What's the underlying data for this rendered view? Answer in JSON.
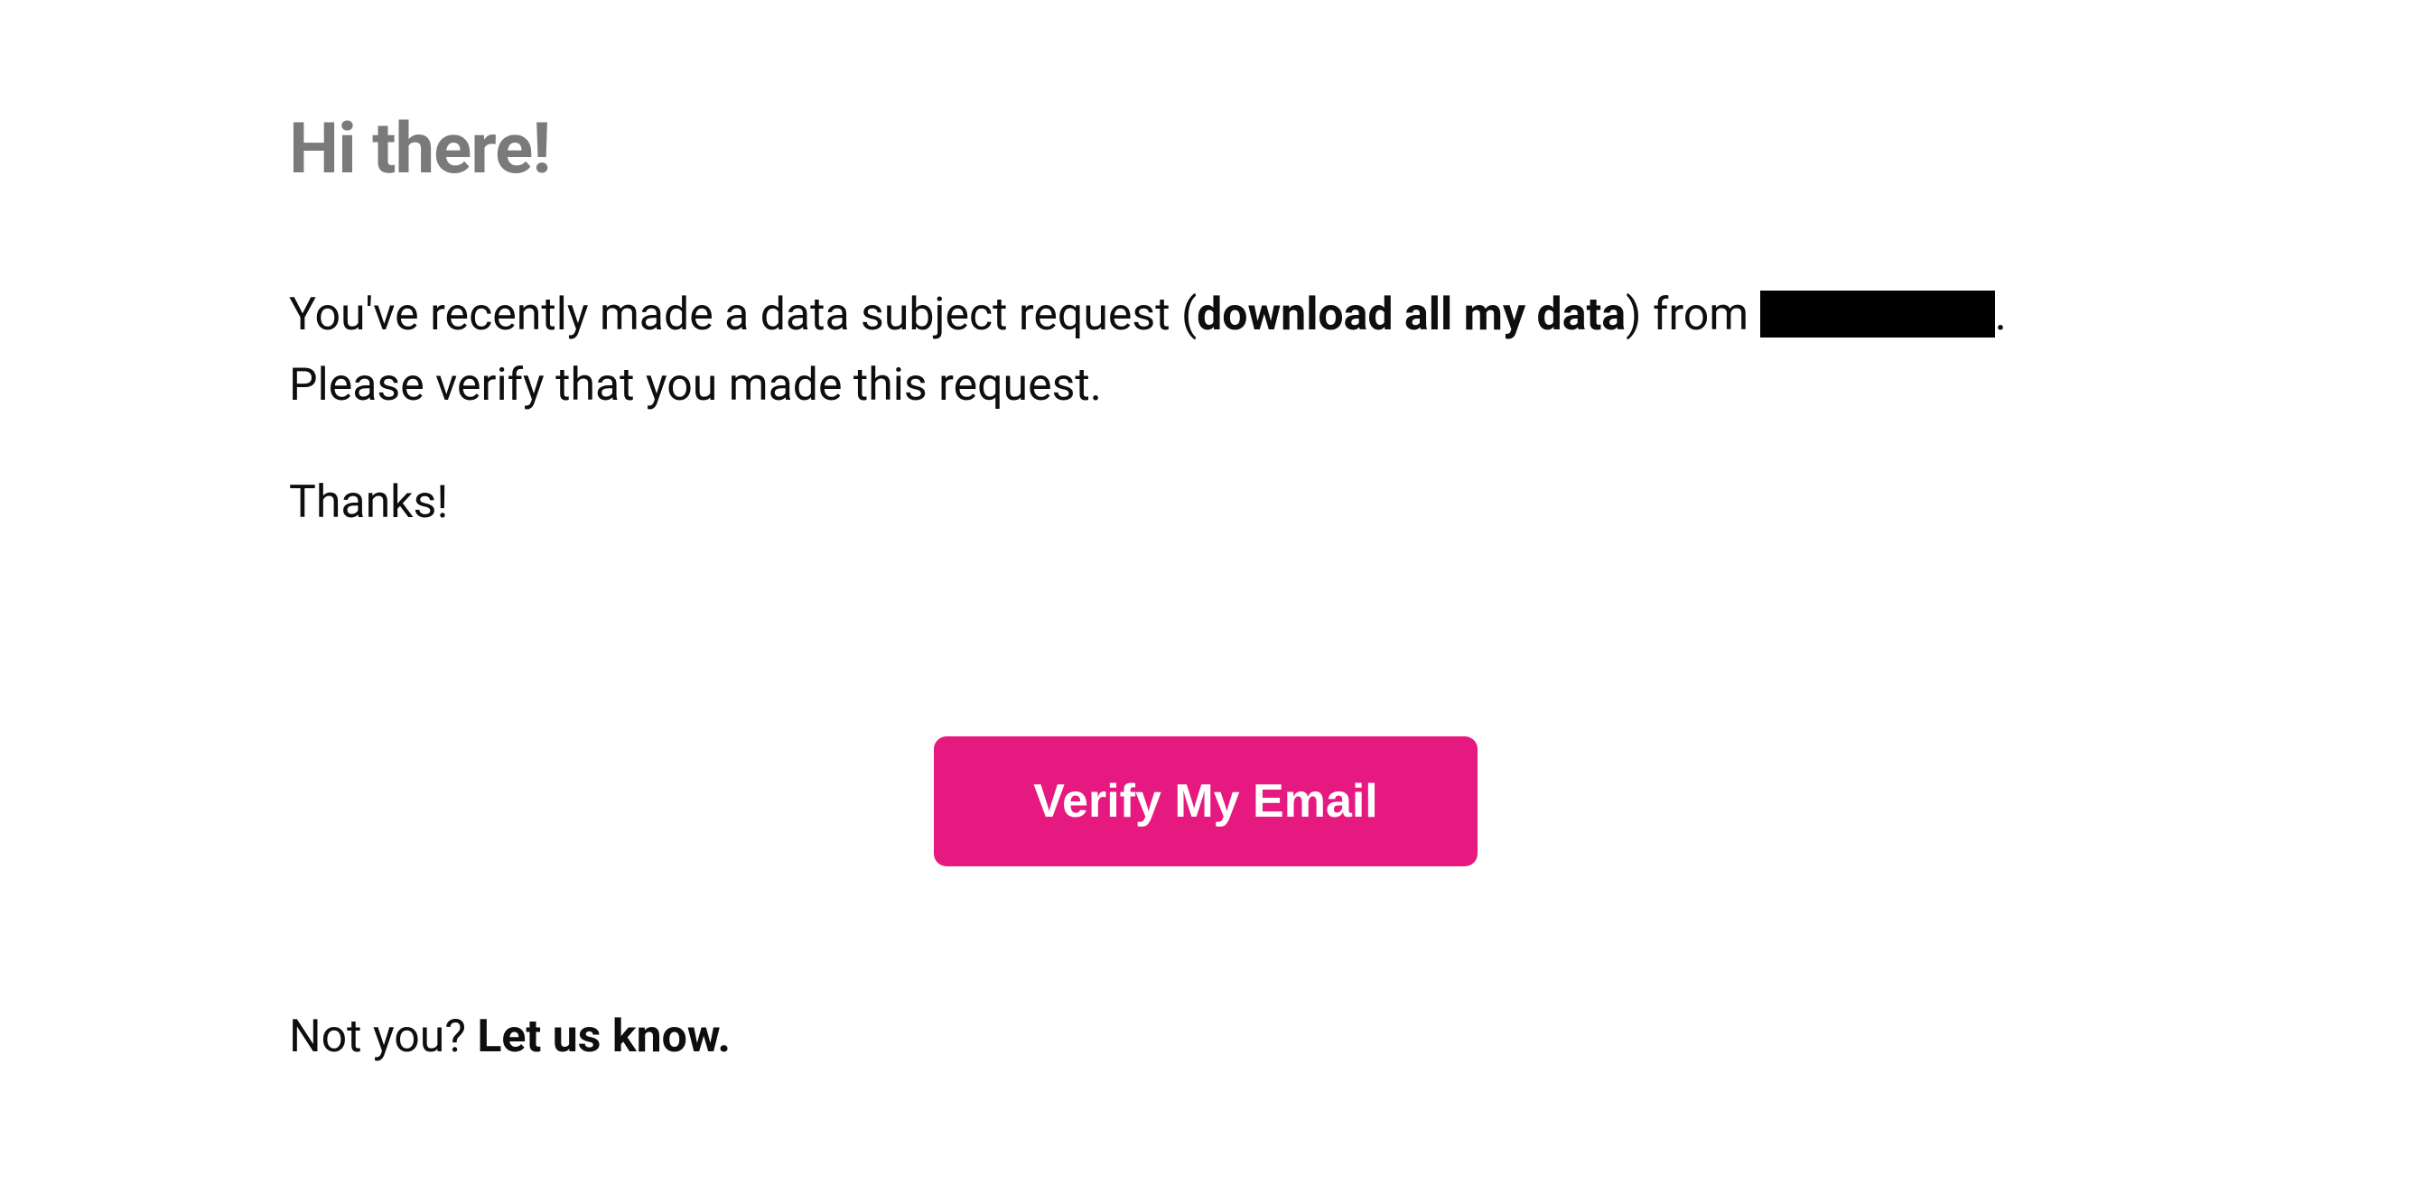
{
  "greeting": "Hi there!",
  "body": {
    "intro": "You've recently made a data subject request (",
    "request_type": "download all my data",
    "after_type": ") from ",
    "redacted_placeholder": "",
    "after_redacted": ". Please verify that you made this request."
  },
  "thanks": "Thanks!",
  "cta": {
    "verify_label": "Verify My Email"
  },
  "footer": {
    "not_you": "Not you? ",
    "let_us_know": "Let us know."
  }
}
